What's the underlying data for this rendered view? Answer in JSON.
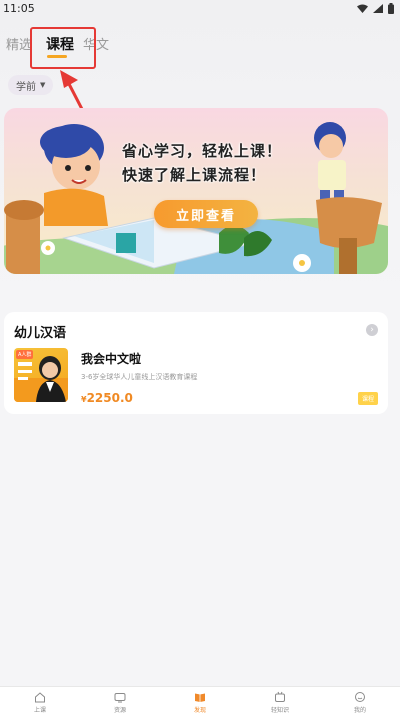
{
  "status_bar": {
    "time": "11:05"
  },
  "tabs": [
    {
      "label": "精选",
      "active": false
    },
    {
      "label": "课程",
      "active": true
    },
    {
      "label": "华文",
      "active": false
    }
  ],
  "filter": {
    "label": "学前"
  },
  "banner": {
    "line1": "省心学习，轻松上课！",
    "line2": "快速了解上课流程！",
    "cta": "立即查看"
  },
  "section": {
    "title": "幼儿汉语",
    "course": {
      "thumb_tag": "A人群",
      "name": "我会中文啦",
      "description": "3-6岁全球华人儿童线上汉语教育课程",
      "price_symbol": "¥",
      "price": "2250.0",
      "badge": "课程"
    }
  },
  "bottom_nav": [
    {
      "label": "上课",
      "icon": "home-icon",
      "active": false
    },
    {
      "label": "资源",
      "icon": "tv-icon",
      "active": false
    },
    {
      "label": "发现",
      "icon": "book-icon",
      "active": true
    },
    {
      "label": "轻知识",
      "icon": "knowledge-icon",
      "active": false
    },
    {
      "label": "我的",
      "icon": "profile-icon",
      "active": false
    }
  ],
  "colors": {
    "accent": "#f5a623",
    "highlight": "#e53935",
    "price": "#f08a24"
  }
}
